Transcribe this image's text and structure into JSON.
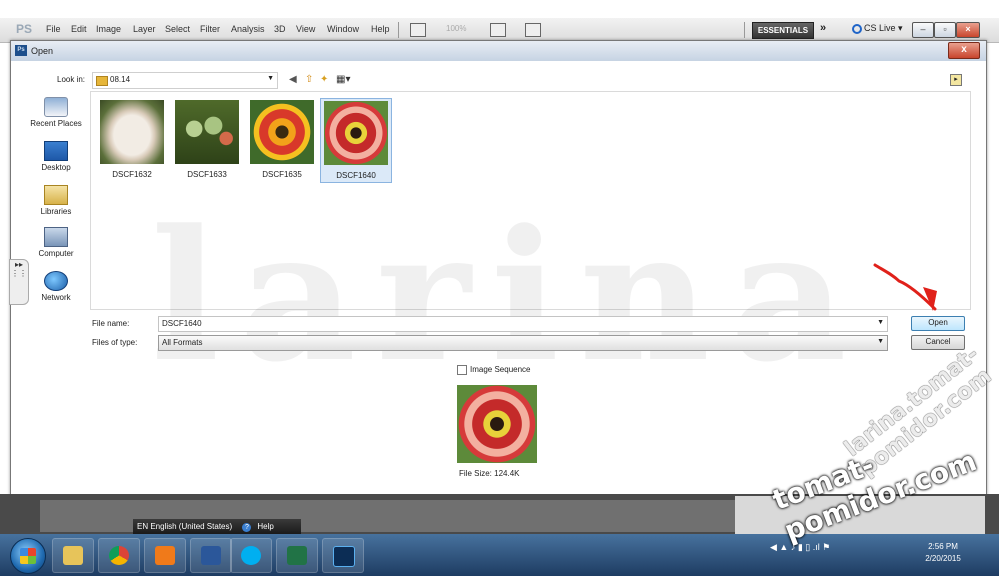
{
  "ps_menubar": {
    "logo": "PS",
    "menus": [
      "File",
      "Edit",
      "Image",
      "Layer",
      "Select",
      "Filter",
      "Analysis",
      "3D",
      "View",
      "Window",
      "Help"
    ],
    "zoom": "100%",
    "workspace": "ESSENTIALS",
    "overflow": "»",
    "cs_live": "CS Live ▾"
  },
  "dialog": {
    "title": "Open",
    "close_label": "x",
    "look_in_label": "Look in:",
    "look_in_value": "08.14",
    "places": [
      {
        "label": "Recent Places",
        "icon": "recent-places-icon"
      },
      {
        "label": "Desktop",
        "icon": "desktop-icon"
      },
      {
        "label": "Libraries",
        "icon": "libraries-icon"
      },
      {
        "label": "Computer",
        "icon": "computer-icon"
      },
      {
        "label": "Network",
        "icon": "network-icon"
      }
    ],
    "files": [
      {
        "name": "DSCF1632",
        "selected": false
      },
      {
        "name": "DSCF1633",
        "selected": false
      },
      {
        "name": "DSCF1635",
        "selected": false
      },
      {
        "name": "DSCF1640",
        "selected": true
      }
    ],
    "file_name_label": "File name:",
    "file_name_value": "DSCF1640",
    "file_type_label": "Files of type:",
    "file_type_value": "All Formats",
    "open_button": "Open",
    "cancel_button": "Cancel",
    "image_sequence_label": "Image Sequence",
    "file_size": "File Size: 124.4K"
  },
  "lang_bar": {
    "language": "EN English (United States)",
    "help": "Help"
  },
  "taskbar": {
    "apps": [
      "explorer",
      "chrome",
      "media-player",
      "word",
      "skype",
      "excel",
      "photoshop"
    ],
    "clock_time": "2:56 PM",
    "clock_date": "2/20/2015"
  },
  "watermarks": {
    "background": "larina",
    "url_large": "tomat-pomidor.com",
    "url_diag": "larina.tomat-pomidor.com"
  },
  "colors": {
    "accent_red": "#e0211a",
    "selection": "#dbe9f8",
    "taskbar": "#1e3c62"
  }
}
